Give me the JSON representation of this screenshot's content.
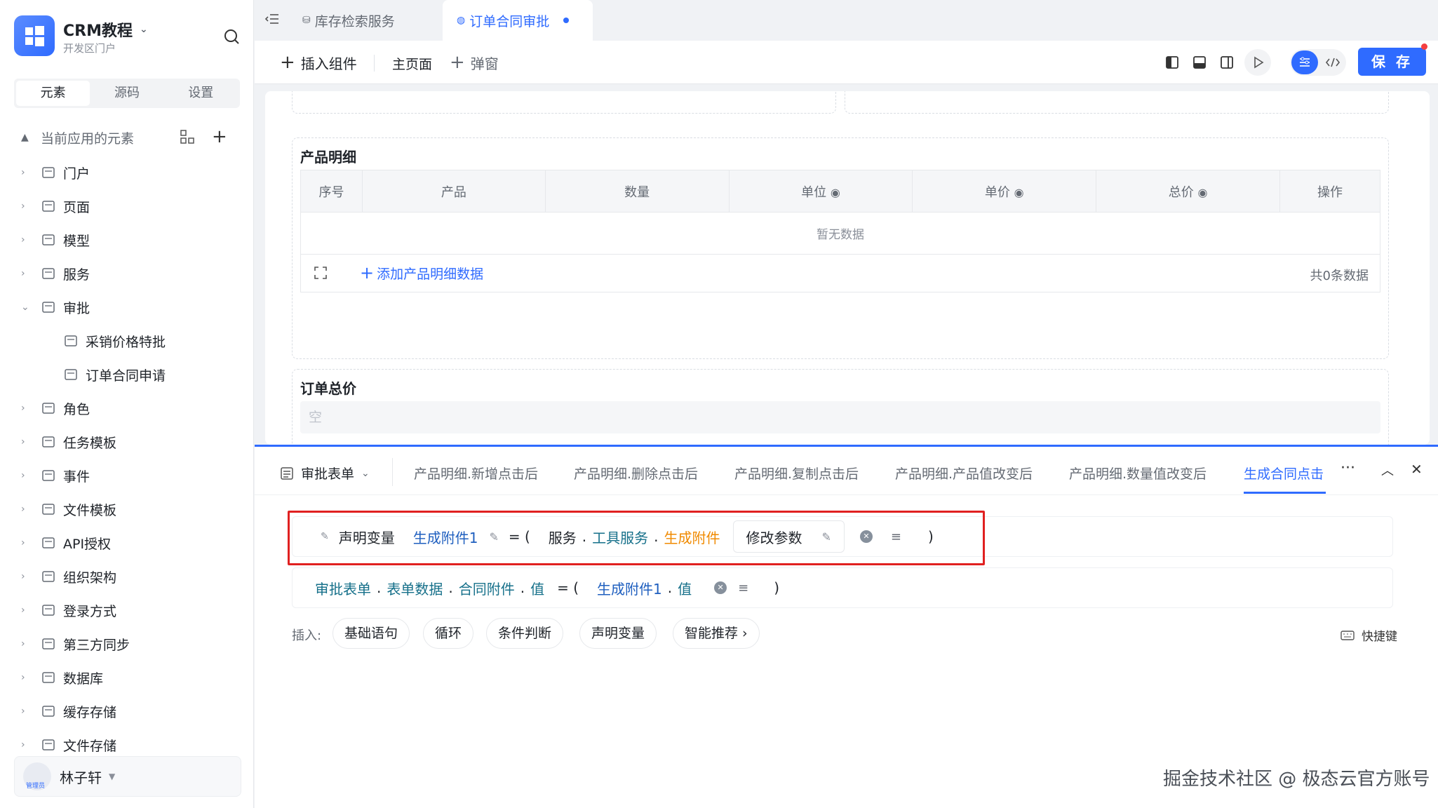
{
  "app": {
    "name": "CRM教程",
    "subtitle": "开发区门户"
  },
  "sidebar": {
    "tabs": [
      {
        "label": "元素"
      },
      {
        "label": "源码"
      },
      {
        "label": "设置"
      }
    ],
    "tree_header": "当前应用的元素",
    "items": [
      {
        "label": "门户",
        "icon": "home-icon"
      },
      {
        "label": "页面",
        "icon": "page-icon"
      },
      {
        "label": "模型",
        "icon": "table-icon"
      },
      {
        "label": "服务",
        "icon": "service-icon"
      },
      {
        "label": "审批",
        "icon": "stamp-icon"
      },
      {
        "label": "采销价格特批",
        "icon": "stamp-icon"
      },
      {
        "label": "订单合同申请",
        "icon": "stamp-icon"
      },
      {
        "label": "角色",
        "icon": "role-icon"
      },
      {
        "label": "任务模板",
        "icon": "task-icon"
      },
      {
        "label": "事件",
        "icon": "event-icon"
      },
      {
        "label": "文件模板",
        "icon": "file-icon"
      },
      {
        "label": "API授权",
        "icon": "key-icon"
      },
      {
        "label": "组织架构",
        "icon": "org-icon"
      },
      {
        "label": "登录方式",
        "icon": "login-icon"
      },
      {
        "label": "第三方同步",
        "icon": "sync-icon"
      },
      {
        "label": "数据库",
        "icon": "database-icon"
      },
      {
        "label": "缓存存储",
        "icon": "cache-icon"
      },
      {
        "label": "文件存储",
        "icon": "storage-icon"
      }
    ],
    "user": {
      "name": "林子轩",
      "role": "管理员"
    }
  },
  "tabs": [
    {
      "label": "库存检索服务"
    },
    {
      "label": "订单合同审批"
    }
  ],
  "toolbar": {
    "insert": "插入组件",
    "main_page": "主页面",
    "popup": "弹窗",
    "save": "保 存"
  },
  "canvas": {
    "product_section": "产品明细",
    "columns": [
      "序号",
      "产品",
      "数量",
      "单位",
      "单价",
      "总价",
      "操作"
    ],
    "empty": "暂无数据",
    "add_row": "添加产品明细数据",
    "total_count": "共0条数据",
    "order_total": "订单总价",
    "order_total_placeholder": "空"
  },
  "panel": {
    "form_select": "审批表单",
    "tabs": [
      "产品明细.新增点击后",
      "产品明细.删除点击后",
      "产品明细.复制点击后",
      "产品明细.产品值改变后",
      "产品明细.数量值改变后",
      "生成合同点击"
    ],
    "line1": {
      "kw": "声明变量",
      "var": "生成附件1",
      "eq": "= (",
      "s1": "服务",
      "dot": ".",
      "s2": "工具服务",
      "s3": "生成附件",
      "param": "修改参数",
      "close": ")"
    },
    "line2": {
      "t1": "审批表单",
      "t2": "表单数据",
      "t3": "合同附件",
      "t4": "值",
      "eq": "= (",
      "t5": "生成附件1",
      "t6": "值",
      "close": ")"
    },
    "insert_label": "插入:",
    "chips": [
      "基础语句",
      "循环",
      "条件判断",
      "声明变量",
      "智能推荐 ›"
    ],
    "shortcut": "快捷键"
  },
  "watermark": "掘金技术社区 @ 极态云官方账号"
}
